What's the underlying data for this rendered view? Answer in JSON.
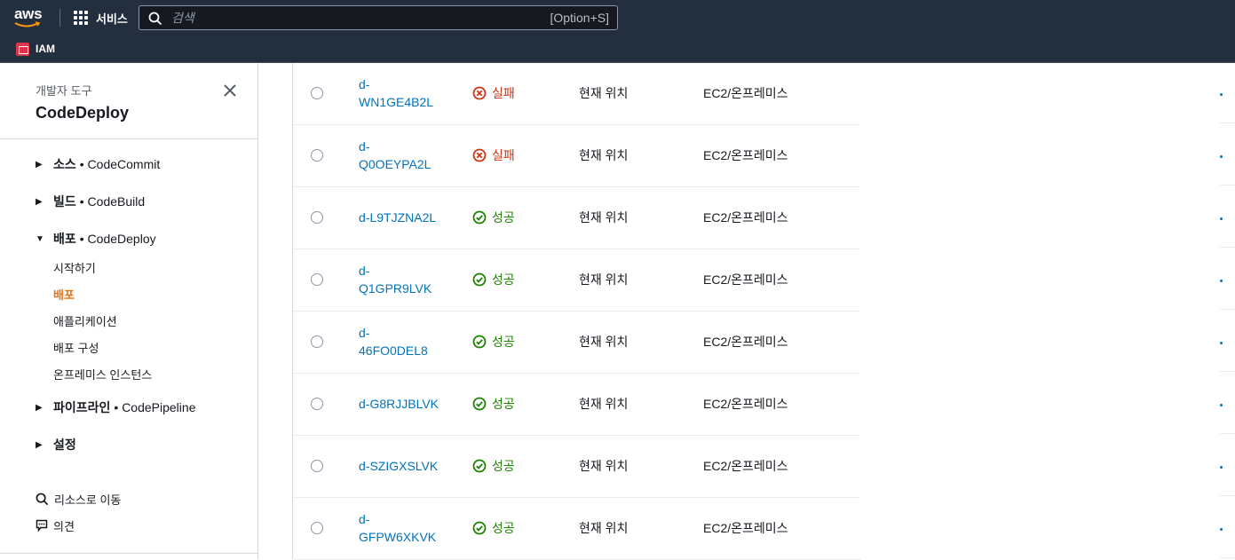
{
  "topnav": {
    "logo_text": "aws",
    "services_label": "서비스",
    "search_placeholder": "검색",
    "search_shortcut": "[Option+S]",
    "favorite": "IAM"
  },
  "sidenav": {
    "subtitle": "개발자 도구",
    "title": "CodeDeploy",
    "sections": [
      {
        "name": "소스",
        "service": "• CodeCommit",
        "expanded": false
      },
      {
        "name": "빌드",
        "service": "• CodeBuild",
        "expanded": false
      },
      {
        "name": "배포",
        "service": "• CodeDeploy",
        "expanded": true
      },
      {
        "name": "파이프라인",
        "service": "• CodePipeline",
        "expanded": false
      },
      {
        "name": "설정",
        "service": "",
        "expanded": false
      }
    ],
    "deploy_items": [
      "시작하기",
      "배포",
      "애플리케이션",
      "배포 구성",
      "온프레미스 인스턴스"
    ],
    "active_item": "배포",
    "footer": {
      "goto": "리소스로 이동",
      "feedback": "의견"
    }
  },
  "table": {
    "rows": [
      {
        "id_line1": "d-",
        "id_line2": "WN1GE4B2L",
        "status": "실패",
        "status_type": "fail",
        "location": "현재 위치",
        "platform": "EC2/온프레미스"
      },
      {
        "id_line1": "d-",
        "id_line2": "Q0OEYPA2L",
        "status": "실패",
        "status_type": "fail",
        "location": "현재 위치",
        "platform": "EC2/온프레미스"
      },
      {
        "id_line1": "d-L9TJZNA2L",
        "id_line2": "",
        "status": "성공",
        "status_type": "ok",
        "location": "현재 위치",
        "platform": "EC2/온프레미스"
      },
      {
        "id_line1": "d-",
        "id_line2": "Q1GPR9LVK",
        "status": "성공",
        "status_type": "ok",
        "location": "현재 위치",
        "platform": "EC2/온프레미스"
      },
      {
        "id_line1": "d-",
        "id_line2": "46FO0DEL8",
        "status": "성공",
        "status_type": "ok",
        "location": "현재 위치",
        "platform": "EC2/온프레미스"
      },
      {
        "id_line1": "d-G8RJJBLVK",
        "id_line2": "",
        "status": "성공",
        "status_type": "ok",
        "location": "현재 위치",
        "platform": "EC2/온프레미스"
      },
      {
        "id_line1": "d-SZIGXSLVK",
        "id_line2": "",
        "status": "성공",
        "status_type": "ok",
        "location": "현재 위치",
        "platform": "EC2/온프레미스"
      },
      {
        "id_line1": "d-",
        "id_line2": "GFPW6XKVK",
        "status": "성공",
        "status_type": "ok",
        "location": "현재 위치",
        "platform": "EC2/온프레미스"
      }
    ]
  },
  "colors": {
    "nav_bg": "#232f3e",
    "link": "#0073bb",
    "fail": "#d13212",
    "ok": "#1d8102",
    "active": "#ec7211"
  }
}
